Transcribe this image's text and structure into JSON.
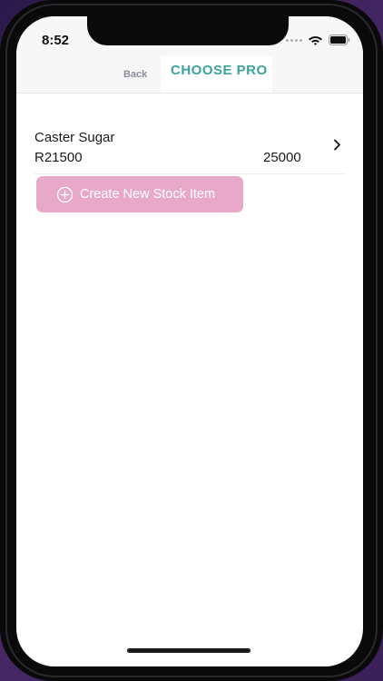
{
  "status_bar": {
    "time": "8:52"
  },
  "nav": {
    "back_label": "Back",
    "title": "CHOOSE PRO"
  },
  "stock_items": [
    {
      "name": "Caster Sugar",
      "price": "R21500",
      "quantity": "25000"
    }
  ],
  "actions": {
    "create_label": "Create New Stock Item"
  },
  "colors": {
    "title_accent": "#3aa39a",
    "create_button": "#e8a9c9",
    "back_text": "#8a8f9c"
  },
  "icons": {
    "plus": "plus-circle-icon",
    "chevron": "chevron-right-icon",
    "signal": "signal-dots-icon",
    "wifi": "wifi-icon",
    "battery": "battery-icon"
  }
}
